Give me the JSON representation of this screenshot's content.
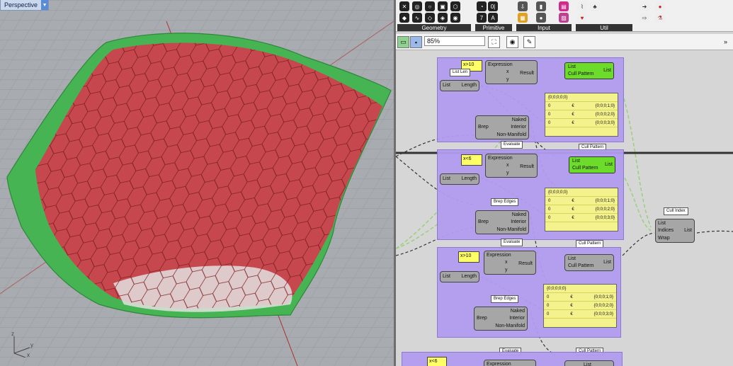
{
  "viewport": {
    "tab_label": "Perspective",
    "axis_x": "x",
    "axis_y": "y",
    "axis_z": "z"
  },
  "ribbon": {
    "groups": [
      {
        "label": "Geometry"
      },
      {
        "label": "Primitive"
      },
      {
        "label": "Input"
      },
      {
        "label": "Util"
      }
    ]
  },
  "toolbar": {
    "zoom": "85%"
  },
  "canvas": {
    "expr1": "x>10",
    "expr2": "x<6",
    "expr3": "x>10",
    "expr4": "x<6",
    "expression_label": "Expression",
    "result_label": "Result",
    "x_label": "x",
    "y_label": "y",
    "list_label": "List",
    "length_label": "Length",
    "brep_label": "Brep",
    "naked_label": "Naked",
    "interior_label": "Interior",
    "nonmanifold_label": "Non-Manifold",
    "cullpattern_label": "Cull Pattern",
    "cull_index_title": "Cull Index",
    "indices_label": "Indices",
    "wrap_label": "Wrap",
    "evaluate_tag": "Evaluate",
    "cullpattern_tag": "Cull Pattern",
    "brepedges_tag": "Brep Edges",
    "listlen_tag": "List Len",
    "panel_rows": [
      "{0;0;0;0;0}",
      "{0;0;0;1;0}",
      "{0;0;0;2;0}",
      "{0;0;0;3;0}"
    ],
    "panel_index": "0",
    "panel_value": "€"
  }
}
